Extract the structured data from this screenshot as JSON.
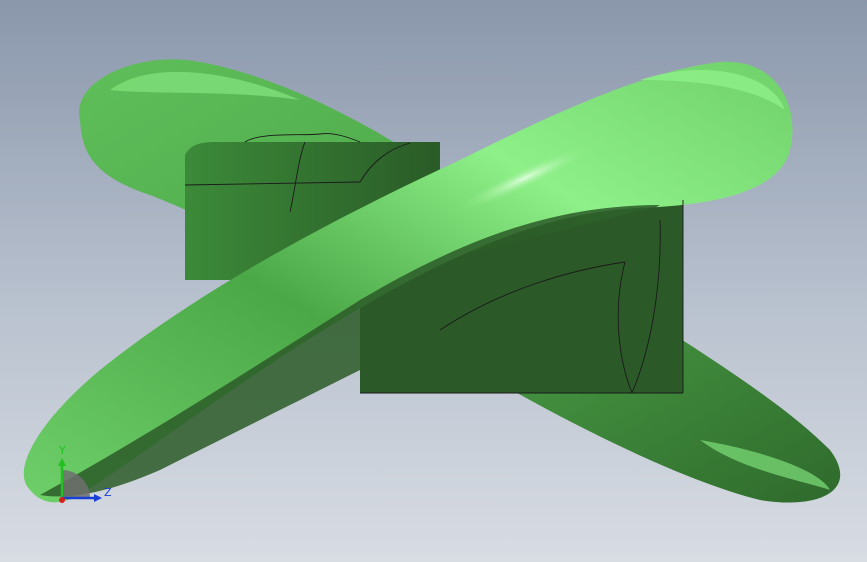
{
  "viewport": {
    "colors": {
      "background_top": "#8a97ab",
      "background_bottom": "#d8dce3",
      "model_light": "#7fe07a",
      "model_mid": "#4ea84a",
      "model_dark": "#2b5a28",
      "edge_line": "#1a1a1a"
    }
  },
  "triad": {
    "y_label": "Y",
    "z_label": "Z",
    "colors": {
      "y_axis": "#22c022",
      "z_axis": "#1a3fd6",
      "x_axis": "#d42020"
    }
  }
}
